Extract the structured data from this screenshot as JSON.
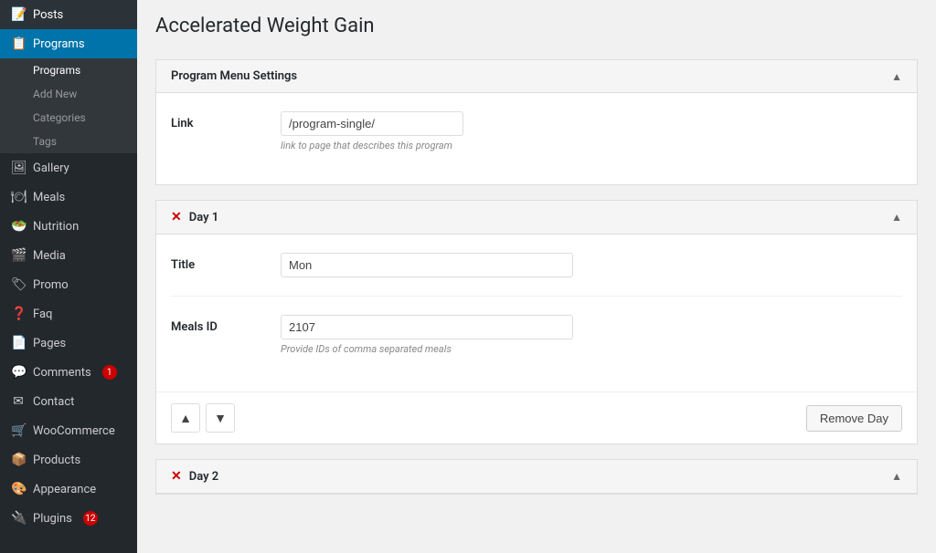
{
  "sidebar": {
    "items": [
      {
        "id": "posts",
        "label": "Posts",
        "icon": "📝",
        "active": false
      },
      {
        "id": "programs",
        "label": "Programs",
        "icon": "📋",
        "active": true
      },
      {
        "id": "gallery",
        "label": "Gallery",
        "icon": "🖼"
      },
      {
        "id": "meals",
        "label": "Meals",
        "icon": "🍽"
      },
      {
        "id": "nutrition",
        "label": "Nutrition",
        "icon": "🥗"
      },
      {
        "id": "media",
        "label": "Media",
        "icon": "🎬"
      },
      {
        "id": "promo",
        "label": "Promo",
        "icon": "🏷"
      },
      {
        "id": "faq",
        "label": "Faq",
        "icon": "❓"
      },
      {
        "id": "pages",
        "label": "Pages",
        "icon": "📄"
      },
      {
        "id": "comments",
        "label": "Comments",
        "icon": "💬",
        "badge": "1"
      },
      {
        "id": "contact",
        "label": "Contact",
        "icon": "✉"
      },
      {
        "id": "woocommerce",
        "label": "WooCommerce",
        "icon": "🛒"
      },
      {
        "id": "products",
        "label": "Products",
        "icon": "📦"
      },
      {
        "id": "appearance",
        "label": "Appearance",
        "icon": "🎨"
      },
      {
        "id": "plugins",
        "label": "Plugins",
        "icon": "🔌",
        "badge": "12"
      }
    ],
    "submenu": {
      "parent": "programs",
      "items": [
        {
          "label": "Programs",
          "active": true
        },
        {
          "label": "Add New",
          "active": false
        },
        {
          "label": "Categories",
          "active": false
        },
        {
          "label": "Tags",
          "active": false
        }
      ]
    }
  },
  "page": {
    "title": "Accelerated Weight Gain"
  },
  "program_menu_settings": {
    "header": "Program Menu Settings",
    "link_label": "Link",
    "link_value": "/program-single/",
    "link_hint": "link to page that describes this program"
  },
  "day1": {
    "header": "Day 1",
    "title_label": "Title",
    "title_value": "Mon",
    "meals_id_label": "Meals ID",
    "meals_id_value": "2107",
    "meals_id_hint": "Provide IDs of comma separated meals",
    "remove_btn": "Remove Day"
  },
  "day2": {
    "header": "Day 2"
  },
  "nav": {
    "up": "▲",
    "down": "▼",
    "collapse": "▲"
  }
}
